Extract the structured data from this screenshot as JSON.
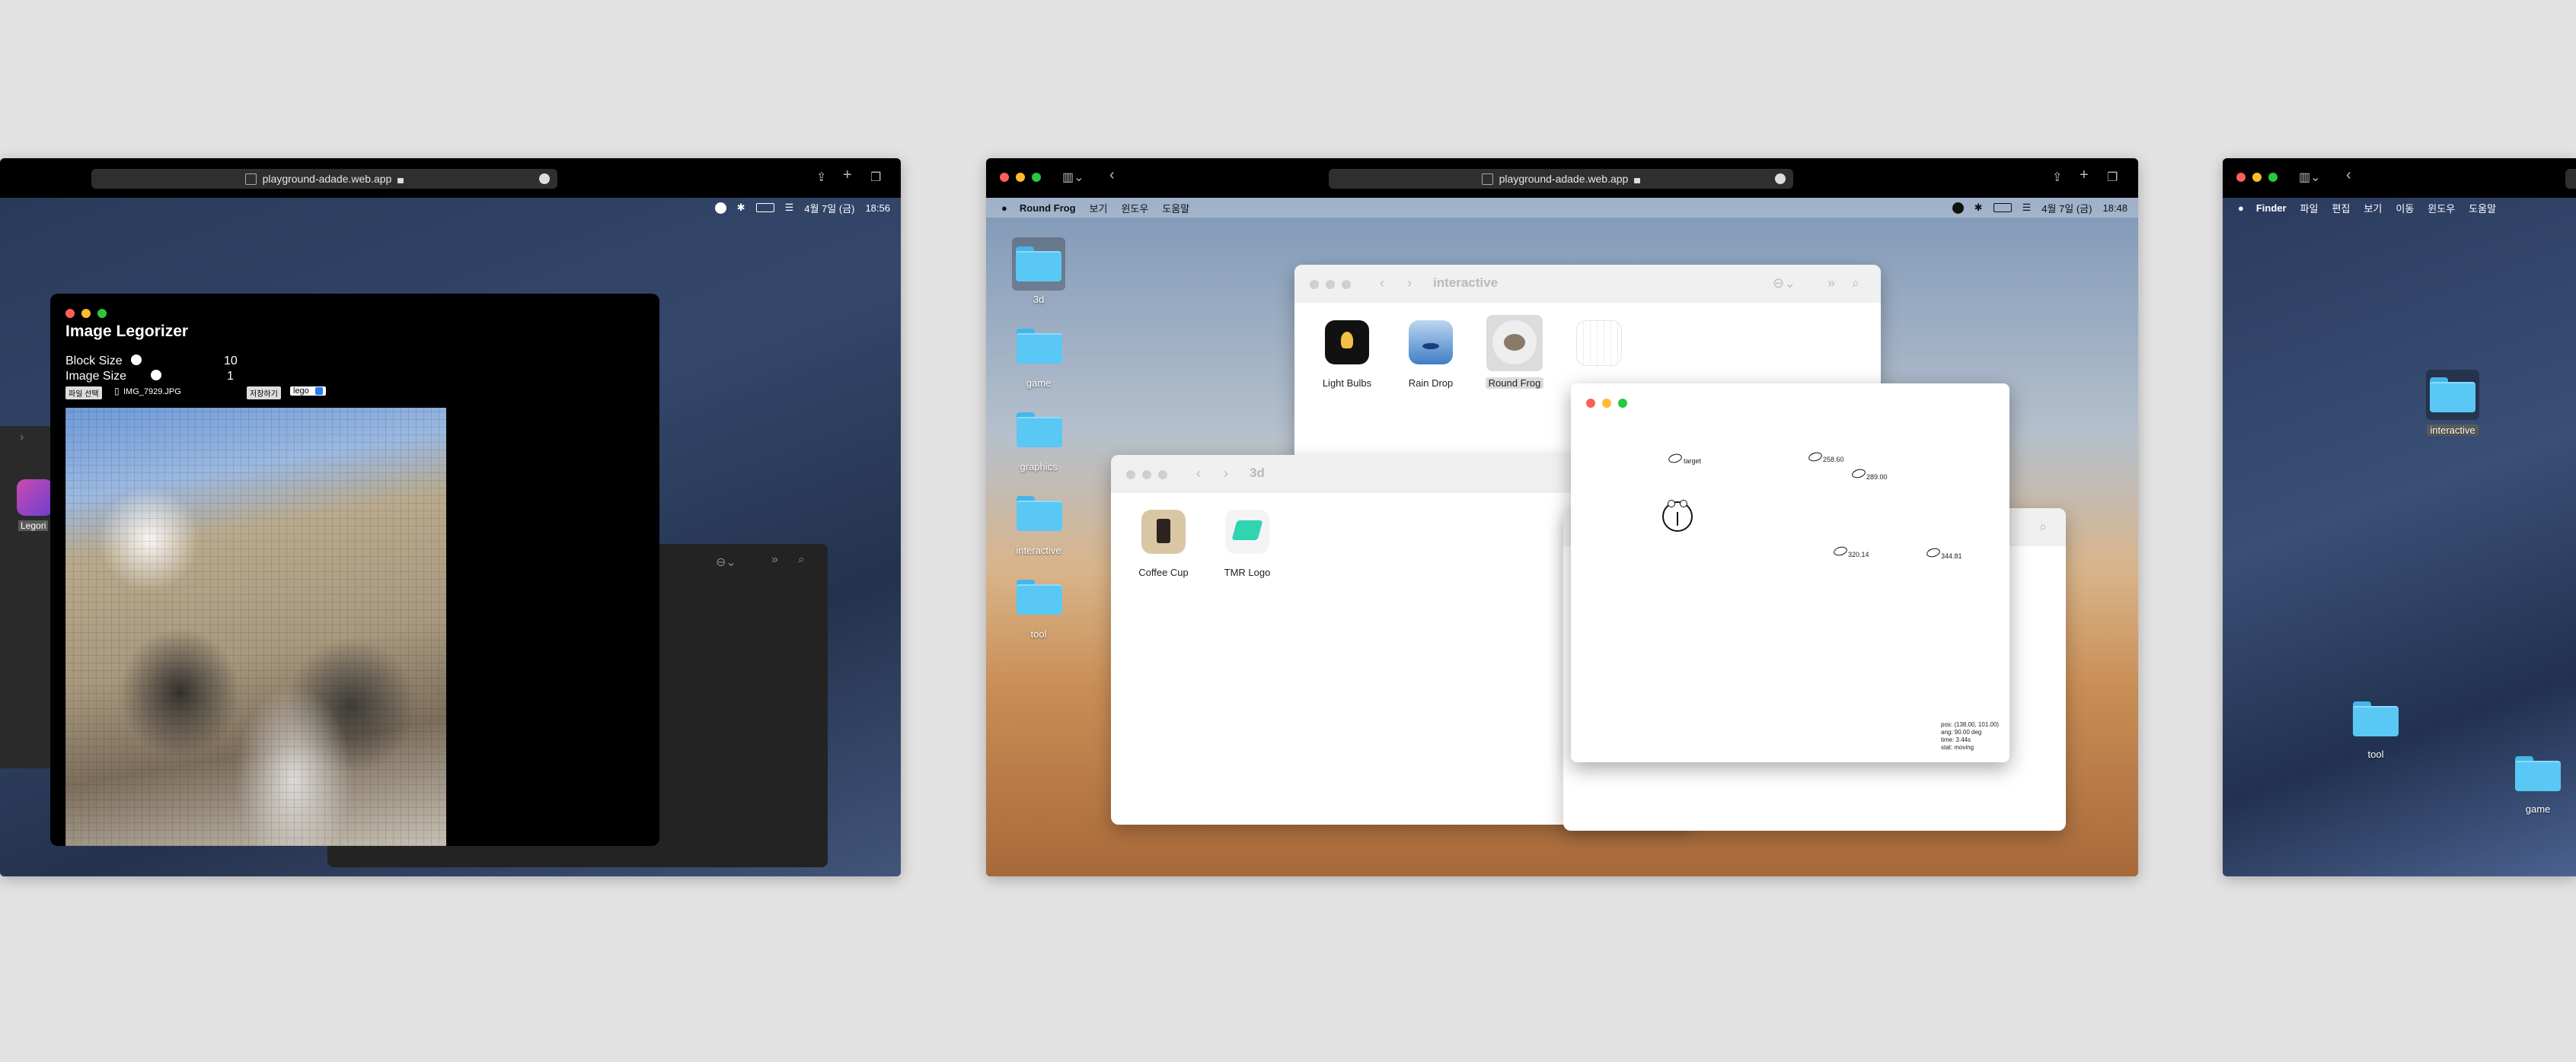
{
  "left_browser": {
    "url": "playground-adade.web.app",
    "status_date": "4월 7일 (금)",
    "status_time": "18:56",
    "app": {
      "title": "Image Legorizer",
      "block_size_label": "Block Size",
      "block_size_value": "10",
      "image_size_label": "Image Size",
      "image_size_value": "1",
      "choose_file_label": "파일 선택",
      "file_name": "IMG_7929.JPG",
      "save_label": "저장하기",
      "style_value": "lego"
    },
    "behind_icon_label": "Legori"
  },
  "center_browser": {
    "url": "playground-adade.web.app",
    "menu": {
      "app_name": "Round Frog",
      "items": [
        "보기",
        "윈도우",
        "도움말"
      ]
    },
    "status_date": "4월 7일 (금)",
    "status_time": "18:48",
    "desktop_folders": [
      "3d",
      "game",
      "graphics",
      "interactive",
      "tool"
    ],
    "interactive_window": {
      "title": "interactive",
      "items": [
        "Light Bulbs",
        "Rain Drop",
        "Round Frog"
      ]
    },
    "threed_window": {
      "title": "3d",
      "items": [
        "Coffee Cup",
        "TMR Logo"
      ]
    },
    "frog_window": {
      "labels": [
        "target",
        "258.60",
        "289.00",
        "320.14",
        "344.81"
      ],
      "status": [
        "pos: (138.00, 101.00)",
        "ang: 90.00 deg",
        "time: 3.44s",
        "stat: moving"
      ]
    }
  },
  "right_browser": {
    "menu": {
      "app_name": "Finder",
      "items": [
        "파일",
        "편집",
        "보기",
        "이동",
        "윈도우",
        "도움말"
      ]
    },
    "desktop_folders": [
      "interactive",
      "tool",
      "game"
    ]
  },
  "colors": {
    "folder": "#5ac8f5",
    "close": "#ff5f57",
    "minimize": "#febc2e",
    "zoom": "#28c840"
  }
}
